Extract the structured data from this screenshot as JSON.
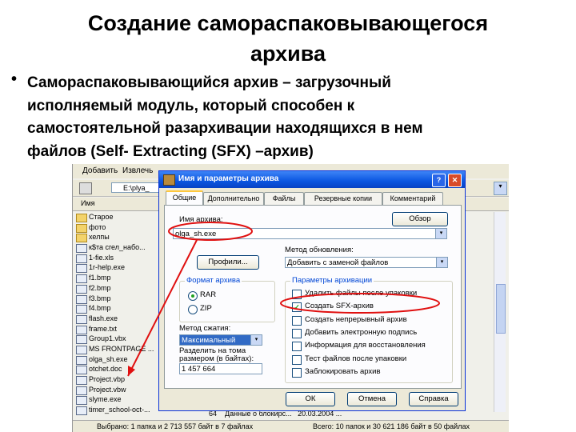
{
  "slide": {
    "title_line1": "Создание самораспаковывающегося",
    "title_line2": "архива",
    "bullet": "•",
    "body_line1": "Самораспаковывающийся архив – загрузочный",
    "body_line2": "исполняемый модуль, который способен к",
    "body_line3": "самостоятельной разархивации находящихся в нем",
    "body_line4": "файлов (Self- Extracting (SFX) –архив)"
  },
  "bg_window": {
    "menu": [
      "Добавить",
      "Извлечь"
    ],
    "path": "E:\\plya_",
    "path_dropdown": "▾",
    "column_header": "Имя",
    "files": [
      {
        "name": "Старое",
        "type": "folder"
      },
      {
        "name": "фото",
        "type": "folder"
      },
      {
        "name": "хелпы",
        "type": "folder"
      },
      {
        "name": "к$та сгел_набо...",
        "type": "file"
      },
      {
        "name": "1-fie.xls",
        "type": "file"
      },
      {
        "name": "1r-help.exe",
        "type": "file"
      },
      {
        "name": "f1.bmp",
        "type": "file"
      },
      {
        "name": "f2.bmp",
        "type": "file"
      },
      {
        "name": "f3.bmp",
        "type": "file"
      },
      {
        "name": "f4.bmp",
        "type": "file"
      },
      {
        "name": "flash.exe",
        "type": "file"
      },
      {
        "name": "frame.txt",
        "type": "file"
      },
      {
        "name": "Group1.vbx",
        "type": "file"
      },
      {
        "name": "MS FRONTPAGE ...",
        "type": "file"
      },
      {
        "name": "olga_sh.exe",
        "type": "file"
      },
      {
        "name": "otchet.doc",
        "type": "file"
      },
      {
        "name": "Project.vbp",
        "type": "file"
      },
      {
        "name": "Project.vbw",
        "type": "file"
      },
      {
        "name": "slyme.exe",
        "type": "file"
      },
      {
        "name": "timer_school-oct-...",
        "type": "file"
      }
    ],
    "bottom_row": {
      "size": "64",
      "type": "Данные о блокирс...",
      "date": "20.03.2004 ..."
    },
    "status_left": "Выбрано: 1 папка и 2 713 557 байт в 7 файлах",
    "status_right": "Всего: 10 папок и 30 621 186 байт в 50 файлах"
  },
  "dialog": {
    "title": "Имя и параметры архива",
    "help": "?",
    "close": "✕",
    "tabs": [
      "Общие",
      "Дополнительно",
      "Файлы",
      "Резервные копии",
      "Комментарий"
    ],
    "archive_name_label": "Имя архива:",
    "browse_button": "Обзор",
    "archive_name": "olga_sh.exe",
    "combo_arrow": "▾",
    "profiles_button": "Профили...",
    "update_method_label": "Метод обновления:",
    "update_method": "Добавить с заменой файлов",
    "format_group": "Формат архива",
    "format_options": [
      "RAR",
      "ZIP"
    ],
    "format_selected": 0,
    "compression_label": "Метод сжатия:",
    "compression": "Максимальный",
    "split_label_line1": "Разделить на тома",
    "split_label_line2": "размером (в байтах):",
    "split_value": "1 457 664",
    "options_group": "Параметры архивации",
    "check_mark": "✓",
    "options": [
      {
        "label": "Удалить файлы после упаковки",
        "checked": false
      },
      {
        "label": "Создать SFX-архив",
        "checked": true
      },
      {
        "label": "Создать непрерывный архив",
        "checked": false
      },
      {
        "label": "Добавить электронную подпись",
        "checked": false
      },
      {
        "label": "Информация для восстановления",
        "checked": false
      },
      {
        "label": "Тест файлов после упаковки",
        "checked": false
      },
      {
        "label": "Заблокировать архив",
        "checked": false
      }
    ],
    "ok_button": "ОК",
    "cancel_button": "Отмена",
    "help_button": "Справка"
  },
  "annotation_color": "#e01010"
}
